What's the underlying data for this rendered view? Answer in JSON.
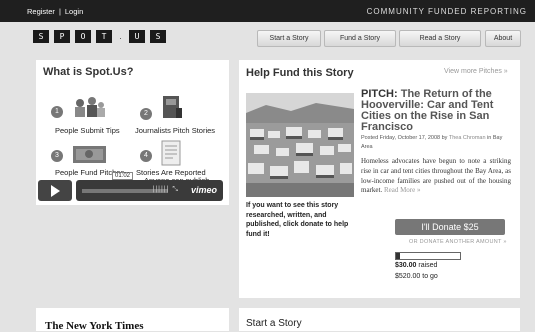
{
  "topbar": {
    "register": "Register",
    "login": "Login",
    "tagline": "COMMUNITY FUNDED REPORTING"
  },
  "logo": {
    "letters": [
      "S",
      "P",
      "O",
      "T",
      "U",
      "S"
    ]
  },
  "nav": {
    "start": "Start a Story",
    "fund": "Fund a Story",
    "read": "Read a Story",
    "about": "About"
  },
  "what": {
    "title": "What is Spot.Us?",
    "steps": [
      {
        "num": "1",
        "label": "People Submit Tips"
      },
      {
        "num": "2",
        "label": "Journalists Pitch Stories"
      },
      {
        "num": "3",
        "label": "People Fund Pitches"
      },
      {
        "num": "4",
        "label": "Stories Are Reported"
      }
    ],
    "caption": "Anyone can publish",
    "video": {
      "time": "01:02",
      "brand": "vimeo"
    }
  },
  "help": {
    "title": "Help Fund this Story",
    "view_more": "View more Pitches »",
    "pitch_label": "PITCH:",
    "pitch_title": "The Return of the Hooverville: Car and Tent Cities on the Rise in San Francisco",
    "posted": "Posted Friday, October 17, 2008 by",
    "author": "Thea Chroman",
    "area": "in Bay Area",
    "description": "Homeless advocates have begun to note a striking rise in car and tent cities throughout the Bay Area, as low-income families are pushed out of the housing market.",
    "read_more": "Read More »",
    "cta": "If you want to see this story researched, written, and published, click donate to help fund it!",
    "donate": "I'll Donate $25",
    "donate_other": "OR DONATE ANOTHER AMOUNT »",
    "progress": 0.06,
    "raised_amount": "$30.00",
    "raised_label": "raised",
    "to_go": "$520.00 to go"
  },
  "bottom": {
    "nyt": "The New York Times",
    "start": "Start a Story"
  },
  "colors": {
    "topbar": "#1f1f1f",
    "background": "#e3e3e3",
    "donate": "#777777"
  }
}
